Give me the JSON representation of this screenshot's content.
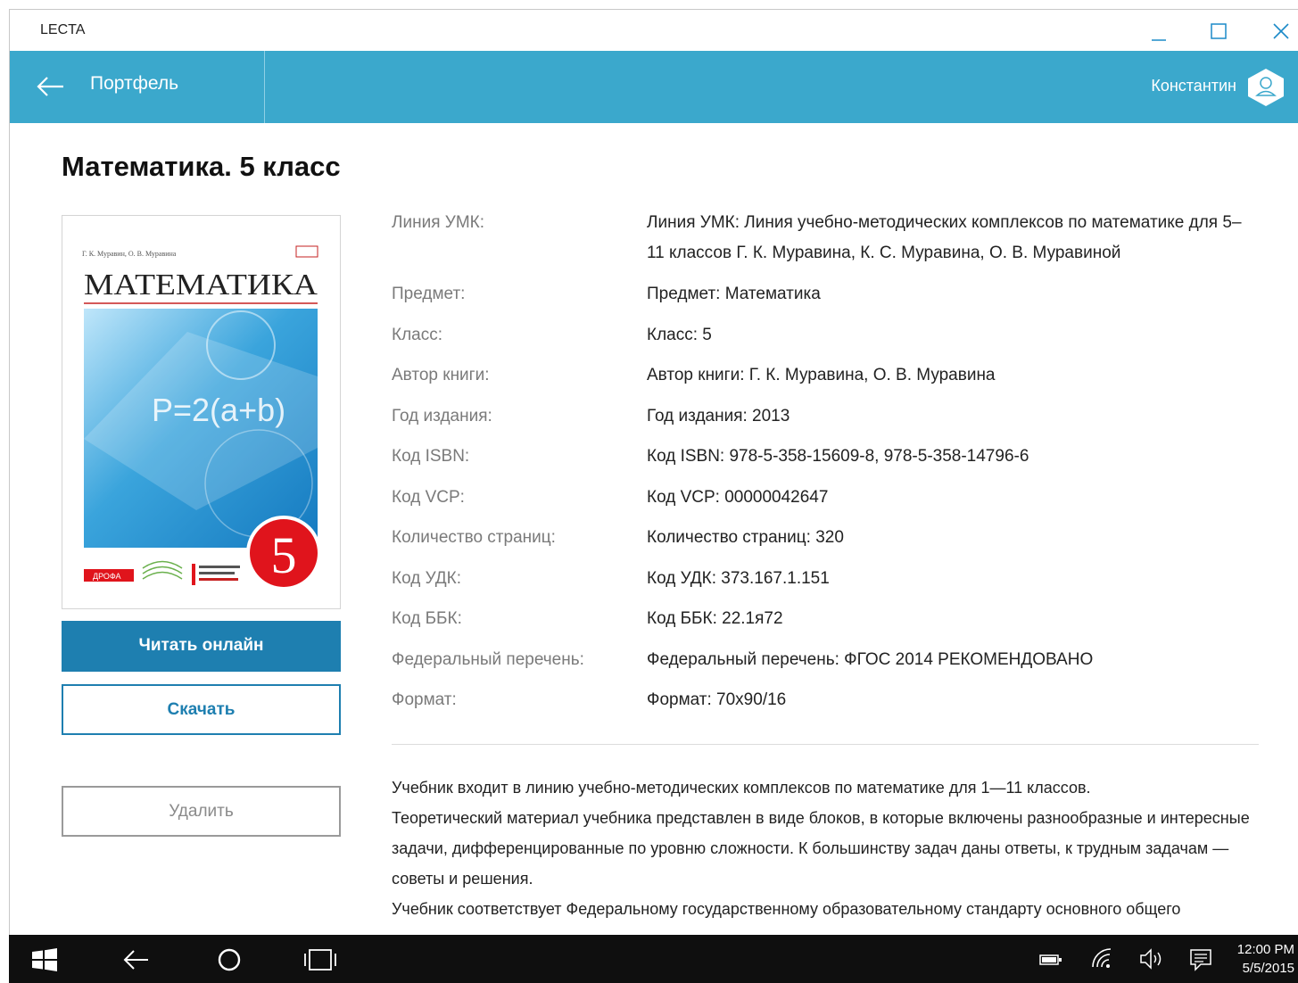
{
  "window": {
    "app_title": "LECTA"
  },
  "header": {
    "back_label": "Портфель",
    "user_name": "Константин"
  },
  "book": {
    "title": "Математика. 5 класс",
    "cover": {
      "authors": "Г. К. Муравин, О. В. Муравина",
      "title": "МАТЕМАТИКА",
      "grade": "5",
      "formula": "P=2(a+b)",
      "publisher": "ДРОФА"
    },
    "read_label": "Читать онлайн",
    "download_label": "Скачать",
    "delete_label": "Удалить",
    "properties": [
      {
        "label": "Линия УМК:",
        "value": "Линия УМК: Линия учебно-методических комплексов по математике для 5–11 классов Г. К. Муравина, К. С. Муравина, О. В. Муравиной"
      },
      {
        "label": "Предмет:",
        "value": "Предмет: Математика"
      },
      {
        "label": "Класс:",
        "value": "Класс: 5"
      },
      {
        "label": "Автор книги:",
        "value": "Автор книги: Г. К. Муравина, О. В. Муравина"
      },
      {
        "label": "Год издания:",
        "value": "Год издания: 2013"
      },
      {
        "label": "Код ISBN:",
        "value": "Код ISBN: 978-5-358-15609-8, 978-5-358-14796-6"
      },
      {
        "label": "Код VCP:",
        "value": "Код VCP: 00000042647"
      },
      {
        "label": "Количество страниц:",
        "value": "Количество страниц: 320"
      },
      {
        "label": "Код УДК:",
        "value": "Код УДК: 373.167.1.151"
      },
      {
        "label": "Код ББК:",
        "value": "Код ББК: 22.1я72"
      },
      {
        "label": "Федеральный перечень:",
        "value": "Федеральный перечень: ФГОС 2014 РЕКОМЕНДОВАНО"
      },
      {
        "label": "Формат:",
        "value": "Формат: 70x90/16"
      }
    ],
    "description": [
      "Учебник входит в линию учебно-методических комплексов по математике для 1—11 классов.",
      "Теоретический материал учебника представлен в виде блоков, в которые включены разнообразные и интересные задачи, дифференцированные по уровню сложности. К большинству задач даны ответы, к трудным задачам — советы и решения.",
      "Учебник соответствует Федеральному государственному образовательному стандарту основного общего"
    ]
  },
  "taskbar": {
    "time": "12:00 PM",
    "date": "5/5/2015"
  },
  "colors": {
    "header": "#3ba8cc",
    "primary_button": "#1e7fb0",
    "taskbar": "#0f0f0f"
  }
}
